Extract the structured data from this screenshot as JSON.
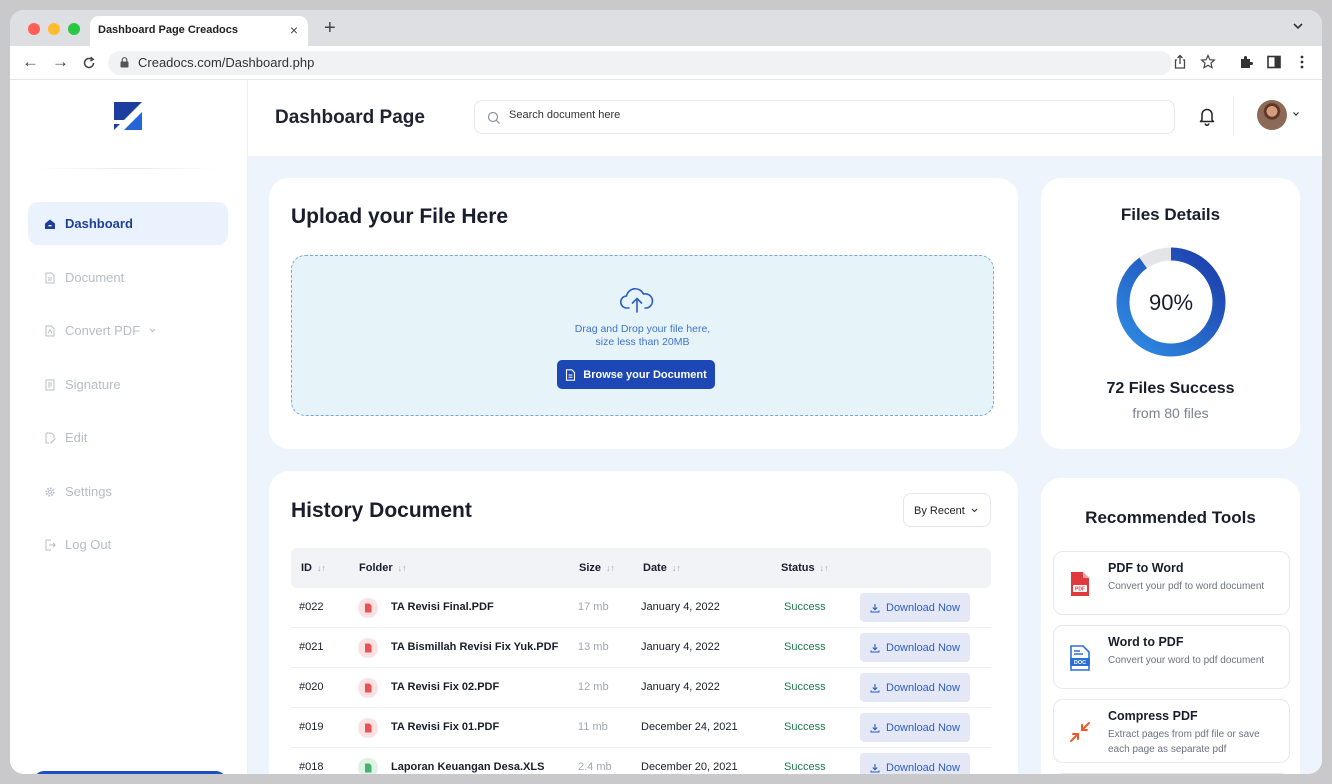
{
  "browser": {
    "tab_title": "Dashboard Page Creadocs",
    "tab_close": "×",
    "new_tab": "+",
    "url": "Creadocs.com/Dashboard.php",
    "back": "←",
    "forward": "→",
    "reload": "C"
  },
  "sidebar": {
    "items": [
      {
        "label": "Dashboard",
        "icon": "home-icon",
        "active": true
      },
      {
        "label": "Document",
        "icon": "document-icon"
      },
      {
        "label": "Convert PDF",
        "icon": "pdf-icon",
        "has_dropdown": true
      },
      {
        "label": "Signature",
        "icon": "signature-icon"
      },
      {
        "label": "Edit",
        "icon": "edit-icon"
      },
      {
        "label": "Settings",
        "icon": "gear-icon"
      },
      {
        "label": "Log Out",
        "icon": "logout-icon"
      }
    ]
  },
  "header": {
    "title": "Dashboard Page",
    "search_placeholder": "Search document here"
  },
  "upload": {
    "title": "Upload your File Here",
    "hint_line1": "Drag and Drop your file here,",
    "hint_line2": "size less than 20MB",
    "button": "Browse your Document"
  },
  "files_details": {
    "title": "Files Details",
    "percent": 90,
    "percent_label": "90%",
    "success_label": "72 Files Success",
    "from_label": "from 80 files"
  },
  "history": {
    "title": "History Document",
    "sort": "By Recent",
    "columns": {
      "id": "ID",
      "folder": "Folder",
      "size": "Size",
      "date": "Date",
      "status": "Status"
    },
    "download_label": "Download Now",
    "rows": [
      {
        "id": "#022",
        "name": "TA Revisi Final.PDF",
        "size": "17 mb",
        "date": "January 4, 2022",
        "status": "Success",
        "type": "pdf"
      },
      {
        "id": "#021",
        "name": "TA Bismillah Revisi Fix Yuk.PDF",
        "size": "13 mb",
        "date": "January 4, 2022",
        "status": "Success",
        "type": "pdf"
      },
      {
        "id": "#020",
        "name": "TA Revisi Fix 02.PDF",
        "size": "12 mb",
        "date": "January 4, 2022",
        "status": "Success",
        "type": "pdf"
      },
      {
        "id": "#019",
        "name": "TA Revisi Fix 01.PDF",
        "size": "11 mb",
        "date": "December 24, 2021",
        "status": "Success",
        "type": "pdf"
      },
      {
        "id": "#018",
        "name": "Laporan Keuangan Desa.XLS",
        "size": "2.4 mb",
        "date": "December 20, 2021",
        "status": "Success",
        "type": "xls"
      }
    ]
  },
  "tools": {
    "title": "Recommended Tools",
    "items": [
      {
        "name": "PDF to Word",
        "desc": "Convert your pdf to word document",
        "icon": "pdf-file-icon"
      },
      {
        "name": "Word to PDF",
        "desc": "Convert your word to pdf document",
        "icon": "doc-file-icon"
      },
      {
        "name": "Compress PDF",
        "desc": "Extract pages from pdf file or save each page as separate pdf",
        "icon": "compress-icon"
      }
    ]
  },
  "colors": {
    "primary": "#1d47b4",
    "accent_blue": "#2d5cc7",
    "success": "#1b7a4c",
    "page_bg": "#eef4fb"
  }
}
